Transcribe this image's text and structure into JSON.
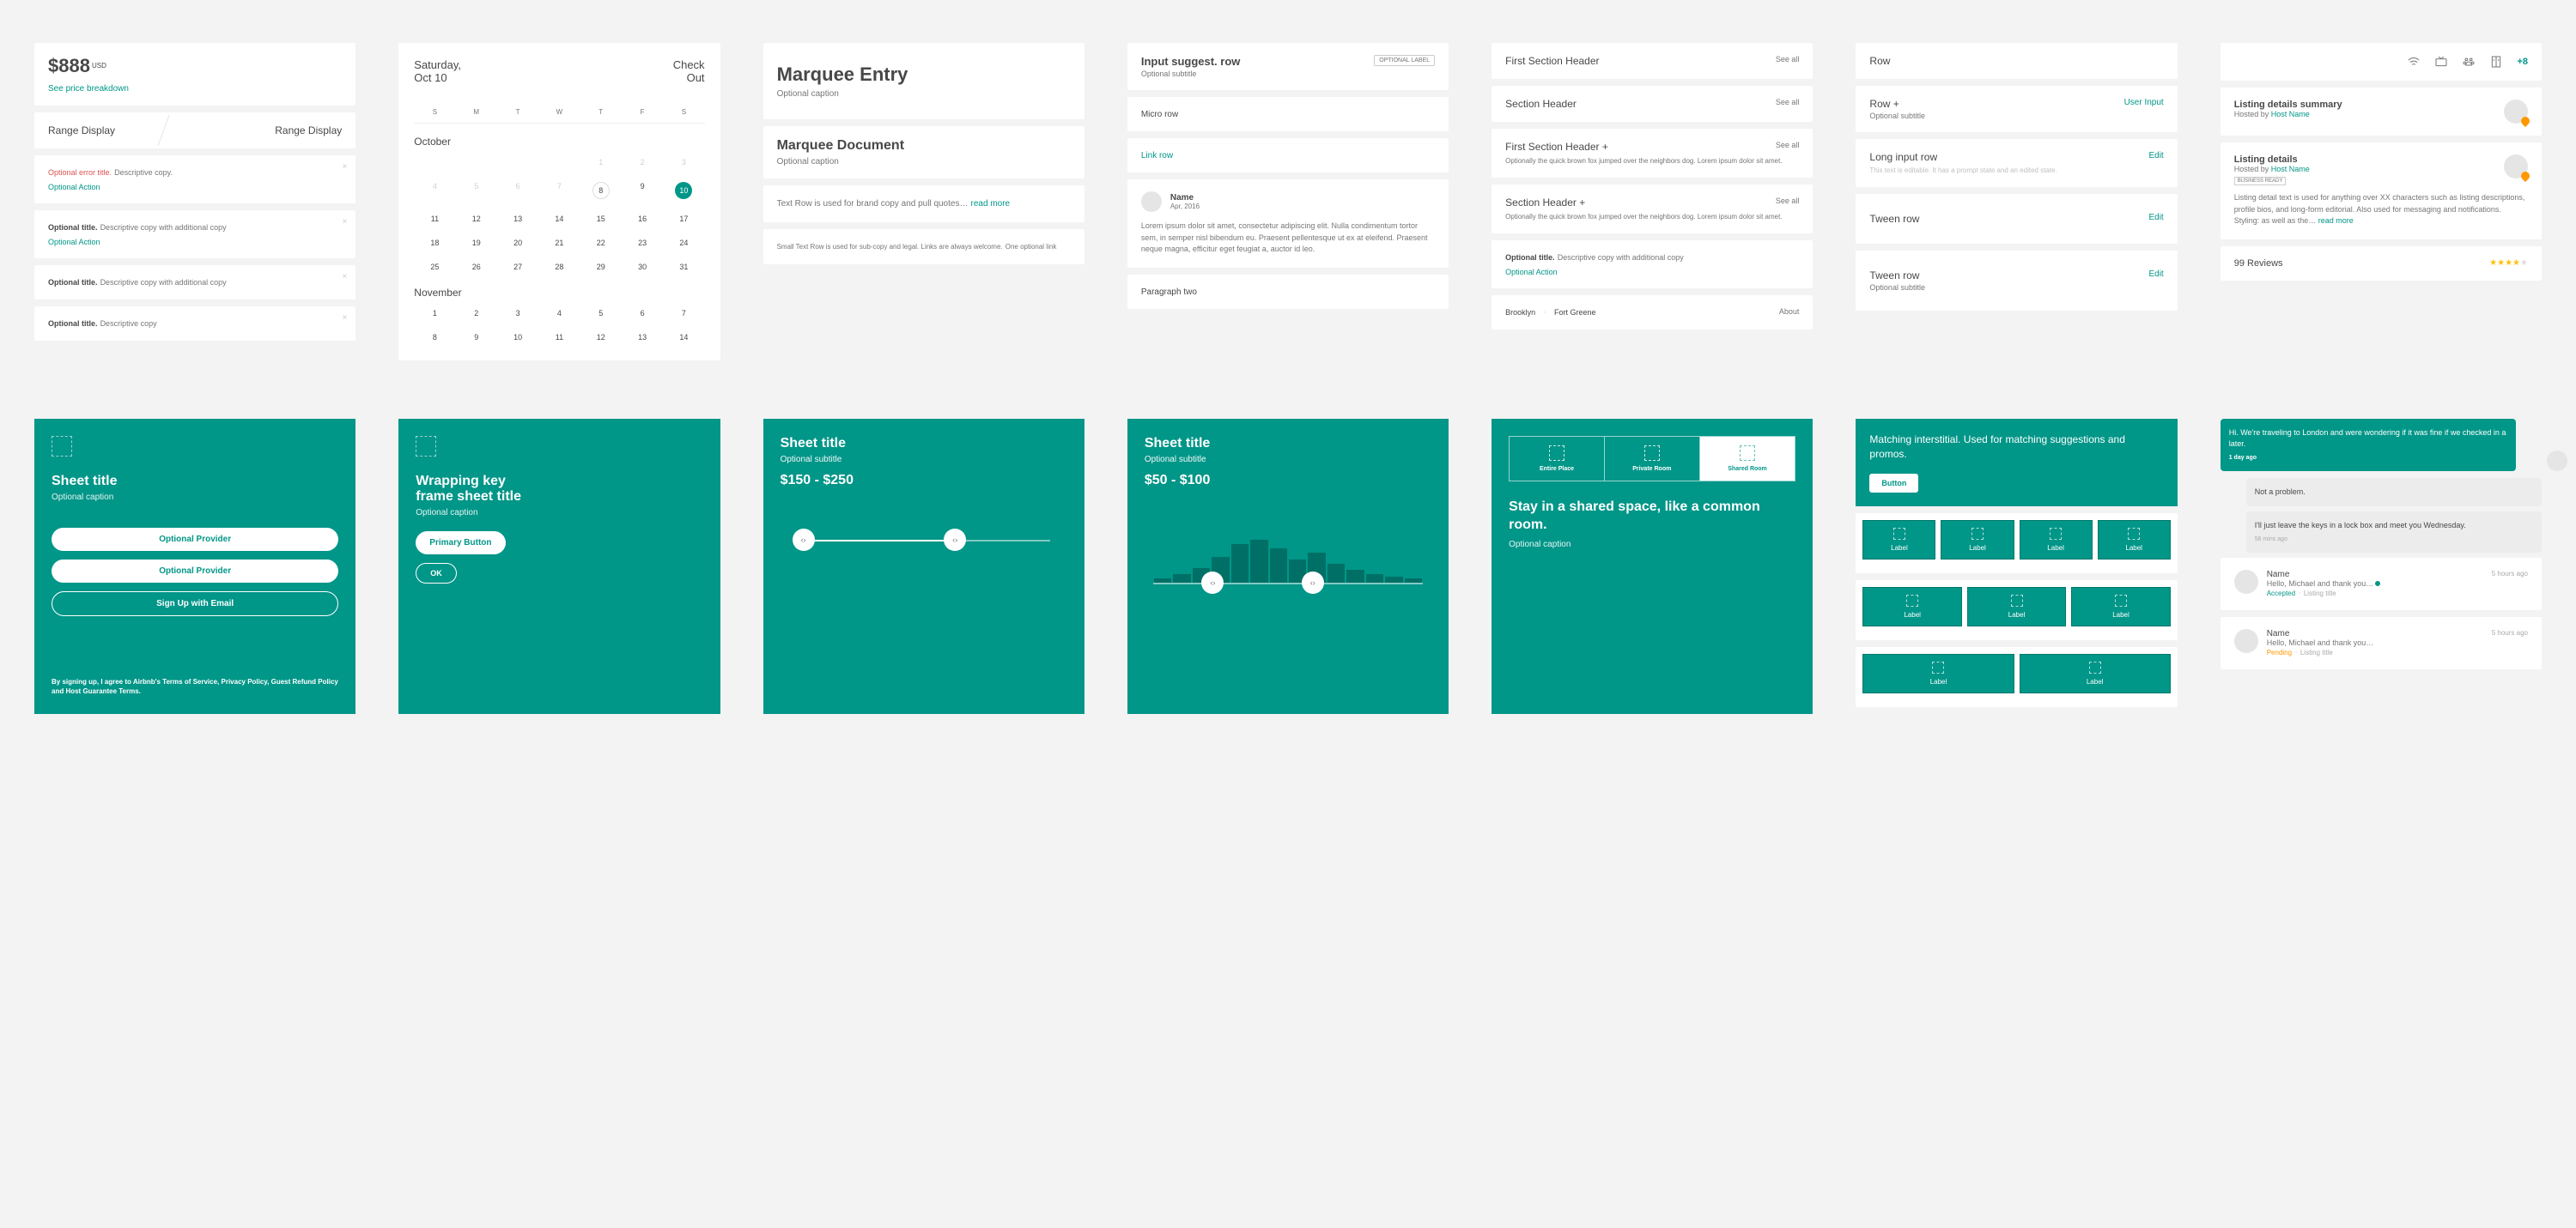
{
  "col1": {
    "price_value": "$888",
    "price_currency": "USD",
    "price_link": "See price breakdown",
    "range_left": "Range Display",
    "range_right": "Range Display",
    "card3_title": "Optional error title.",
    "card3_copy": "Descriptive copy.",
    "card3_action": "Optional Action",
    "card4_title": "Optional title.",
    "card4_copy": "Descriptive copy with additional copy",
    "card4_action": "Optional Action",
    "card5_title": "Optional title.",
    "card5_copy": "Descriptive copy with additional copy",
    "card6_title": "Optional title.",
    "card6_copy": "Descriptive copy"
  },
  "col2": {
    "sel_day": "Saturday,",
    "sel_date": "Oct 10",
    "mode1": "Check",
    "mode2": "Out",
    "days": [
      "S",
      "M",
      "T",
      "W",
      "T",
      "F",
      "S"
    ],
    "month1": "October",
    "month2": "November",
    "oct": [
      "",
      "",
      "",
      "",
      "1",
      "2",
      "3",
      "4",
      "5",
      "6",
      "7",
      "8",
      "9",
      "10",
      "11",
      "12",
      "13",
      "14",
      "15",
      "16",
      "17",
      "18",
      "19",
      "20",
      "21",
      "22",
      "23",
      "24",
      "25",
      "26",
      "27",
      "28",
      "29",
      "30",
      "31"
    ],
    "nov": [
      "1",
      "2",
      "3",
      "4",
      "5",
      "6",
      "7",
      "8",
      "9",
      "10",
      "11",
      "12",
      "13",
      "14"
    ],
    "ringed": "8",
    "selected": "10",
    "dim_until": 7
  },
  "col3": {
    "marquee_title": "Marquee Entry",
    "marquee_cap": "Optional caption",
    "doc_title": "Marquee Document",
    "doc_cap": "Optional caption",
    "text_row": "Text Row is used for brand copy and pull quotes…",
    "read_more": "read more",
    "small_text": "Small Text Row is used for sub-copy and legal. Links are always welcome.",
    "small_link": "One optional link"
  },
  "col4": {
    "r1_title": "Input suggest. row",
    "r1_sub": "Optional subtitle",
    "r1_label": "OPTIONAL LABEL",
    "r2": "Micro row",
    "r3": "Link row",
    "r4_name": "Name",
    "r4_date": "Apr, 2016",
    "r4_body": "Lorem ipsum dolor sit amet, consectetur adipiscing elit. Nulla condimentum tortor sem, in semper nisl bibendum eu. Praesent pellentesque ut ex at eleifend. Praesent neque magna, efficitur eget feugiat a, auctor id leo.",
    "r5": "Paragraph two"
  },
  "col5": {
    "see_all": "See all",
    "h1": "First Section Header",
    "h2": "Section Header",
    "h3": "First Section Header +",
    "h3_sub": "Optionally the quick brown fox jumped over the neighbors dog. Lorem ipsum dolor sit amet.",
    "h4": "Section Header +",
    "h4_sub": "Optionally the quick brown fox jumped over the neighbors dog. Lorem ipsum dolor sit amet.",
    "h5_title": "Optional title.",
    "h5_copy": "Descriptive copy with additional copy",
    "h5_action": "Optional Action",
    "crumb1": "Brooklyn",
    "crumb2": "Fort Greene",
    "crumb_about": "About"
  },
  "col6": {
    "r1": "Row",
    "r2": "Row +",
    "r2_sub": "Optional subtitle",
    "r2_val": "User Input",
    "r3": "Long input row",
    "r3_val": "Edit",
    "r3_prompt": "This text is editable. It has a prompt state and an edited state.",
    "r4": "Tween row",
    "r4_val": "Edit",
    "r5": "Tween row",
    "r5_sub": "Optional subtitle",
    "r5_val": "Edit"
  },
  "col7": {
    "plus": "+8",
    "l1_title": "Listing details summary",
    "hosted_by": "Hosted by",
    "host_name": "Host Name",
    "l2_title": "Listing details",
    "biz_badge": "BUSINESS READY",
    "l2_body": "Listing detail text is used for anything over XX characters such as listing descriptions, profile bios, and long-form editorial. Also used for messaging and notifications. Styling: as well as the…",
    "read_more": "read more",
    "reviews": "99 Reviews"
  },
  "teal1": {
    "title": "Sheet title",
    "caption": "Optional caption",
    "btn1": "Optional Provider",
    "btn2": "Optional Provider",
    "btn3": "Sign Up with Email",
    "legal": "By signing up, I agree to Airbnb's Terms of Service, Privacy Policy, Guest Refund Policy and Host Guarantee Terms."
  },
  "teal2": {
    "title": "Wrapping key frame sheet title",
    "caption": "Optional caption",
    "btn1": "Primary Button",
    "btn2": "OK"
  },
  "teal3": {
    "title": "Sheet title",
    "sub": "Optional subtitle",
    "price": "$150 - $250"
  },
  "teal4": {
    "title": "Sheet title",
    "sub": "Optional subtitle",
    "price": "$50 - $100"
  },
  "teal5": {
    "opts": [
      "Entire Place",
      "Private Room",
      "Shared Room"
    ],
    "stay_title": "Stay in a shared space, like a common room.",
    "stay_cap": "Optional caption"
  },
  "teal6": {
    "match_txt": "Matching interstitial. Used for matching suggestions and promos.",
    "btn": "Button",
    "label": "Label"
  },
  "msgs": {
    "out_body": "Hi. We're traveling to London and were wondering if it was fine if we checked in a later.",
    "out_time": "1 day ago",
    "in1": "Not a problem.",
    "in2": "I'll just leave the keys in a lock box and meet you Wednesday.",
    "in2_time": "56 mins ago",
    "t1_name": "Name",
    "t1_time": "5 hours ago",
    "t1_msg": "Hello, Michael and thank you…",
    "t1_status": "Accepted",
    "t1_listing": "Listing title",
    "t2_name": "Name",
    "t2_time": "5 hours ago",
    "t2_msg": "Hello, Michael and thank you…",
    "t2_status": "Pending",
    "t2_listing": "Listing title"
  }
}
